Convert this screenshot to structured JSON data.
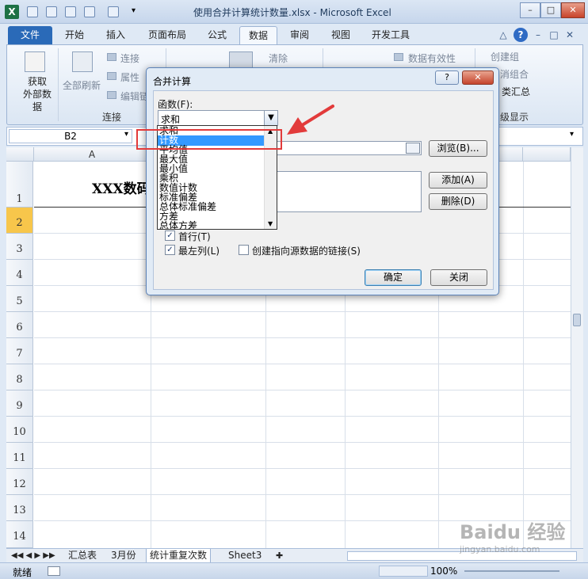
{
  "window": {
    "title": "使用合并计算统计数量.xlsx - Microsoft Excel",
    "app_icon": "X"
  },
  "ribbon_tabs": [
    "文件",
    "开始",
    "插入",
    "页面布局",
    "公式",
    "数据",
    "审阅",
    "视图",
    "开发工具"
  ],
  "ribbon": {
    "get_external": "获取\n外部数据",
    "refresh_all": "全部刷新",
    "connections": "连接",
    "properties": "属性",
    "edit_links": "编辑链",
    "group_connections": "连接",
    "clear": "清除",
    "data_validation": "数据有效性",
    "create_group": "创建组",
    "ungroup": "消组合",
    "subtotal": "类汇总",
    "group_outline": "级显示"
  },
  "formula_bar": {
    "name_box": "B2",
    "fx": "fx"
  },
  "grid": {
    "col_headers": [
      "A",
      "F"
    ],
    "row_headers": [
      "1",
      "2",
      "3",
      "4",
      "5",
      "6",
      "7",
      "8",
      "9",
      "10",
      "11",
      "12",
      "13",
      "14"
    ],
    "cell_a1": "XXX数码"
  },
  "sheet_tabs": [
    "汇总表",
    "3月份",
    "统计重复次数",
    "Sheet3"
  ],
  "status": {
    "ready": "就绪",
    "zoom": "100%"
  },
  "dialog": {
    "title": "合并计算",
    "help": "?",
    "close": "✕",
    "function_label": "函数(F):",
    "function_value": "求和",
    "browse": "浏览(B)...",
    "add": "添加(A)",
    "delete": "删除(D)",
    "first_row": "首行(T)",
    "left_col": "最左列(L)",
    "create_links": "创建指向源数据的链接(S)",
    "ok": "确定",
    "close_btn": "关闭",
    "options": [
      "求和",
      "计数",
      "平均值",
      "最大值",
      "最小值",
      "乘积",
      "数值计数",
      "标准偏差",
      "总体标准偏差",
      "方差",
      "总体方差"
    ],
    "selected_option_index": 1
  },
  "watermark": "Baidu 经验",
  "watermark_url": "jingyan.baidu.com",
  "colors": {
    "highlight_box": "#e23b3b",
    "selected_option": "#3399ff",
    "file_tab": "#2a6ab8"
  }
}
